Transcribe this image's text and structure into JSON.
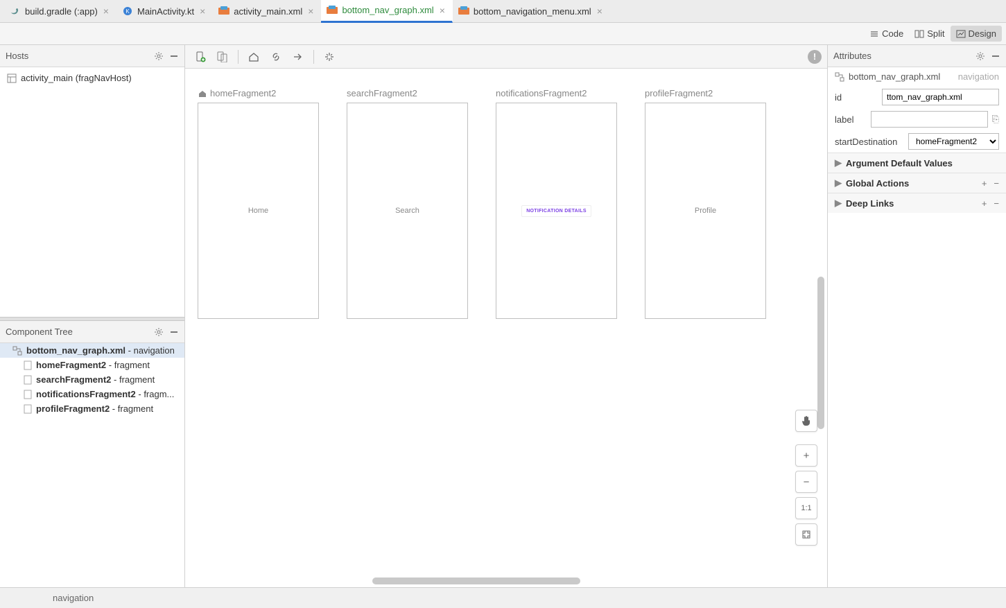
{
  "tabs": [
    {
      "label": "build.gradle (:app)",
      "icon": "gradle",
      "active": false
    },
    {
      "label": "MainActivity.kt",
      "icon": "kotlin",
      "active": false
    },
    {
      "label": "activity_main.xml",
      "icon": "xml",
      "active": false
    },
    {
      "label": "bottom_nav_graph.xml",
      "icon": "xml",
      "active": true
    },
    {
      "label": "bottom_navigation_menu.xml",
      "icon": "xml",
      "active": false
    }
  ],
  "viewModes": {
    "code": "Code",
    "split": "Split",
    "design": "Design",
    "selected": "design"
  },
  "hosts": {
    "title": "Hosts",
    "items": [
      {
        "label": "activity_main (fragNavHost)"
      }
    ]
  },
  "componentTree": {
    "title": "Component Tree",
    "root": {
      "name": "bottom_nav_graph.xml",
      "type": "navigation"
    },
    "items": [
      {
        "name": "homeFragment2",
        "type": "fragment"
      },
      {
        "name": "searchFragment2",
        "type": "fragment"
      },
      {
        "name": "notificationsFragment2",
        "type": "fragm..."
      },
      {
        "name": "profileFragment2",
        "type": "fragment"
      }
    ]
  },
  "canvas": {
    "fragments": [
      {
        "title": "homeFragment2",
        "content": "Home",
        "start": true
      },
      {
        "title": "searchFragment2",
        "content": "Search",
        "start": false
      },
      {
        "title": "notificationsFragment2",
        "content": "NOTIFICATION DETAILS",
        "notif": true,
        "start": false
      },
      {
        "title": "profileFragment2",
        "content": "Profile",
        "start": false
      }
    ],
    "zoom": {
      "oneToOne": "1:1"
    }
  },
  "attributes": {
    "title": "Attributes",
    "fileName": "bottom_nav_graph.xml",
    "fileType": "navigation",
    "fields": {
      "idLabel": "id",
      "idValue": "ttom_nav_graph.xml",
      "labelLabel": "label",
      "labelValue": "",
      "startLabel": "startDestination",
      "startValue": "homeFragment2"
    },
    "sections": {
      "argDefault": "Argument Default Values",
      "globalActions": "Global Actions",
      "deepLinks": "Deep Links"
    }
  },
  "statusBar": {
    "mode": "navigation"
  }
}
